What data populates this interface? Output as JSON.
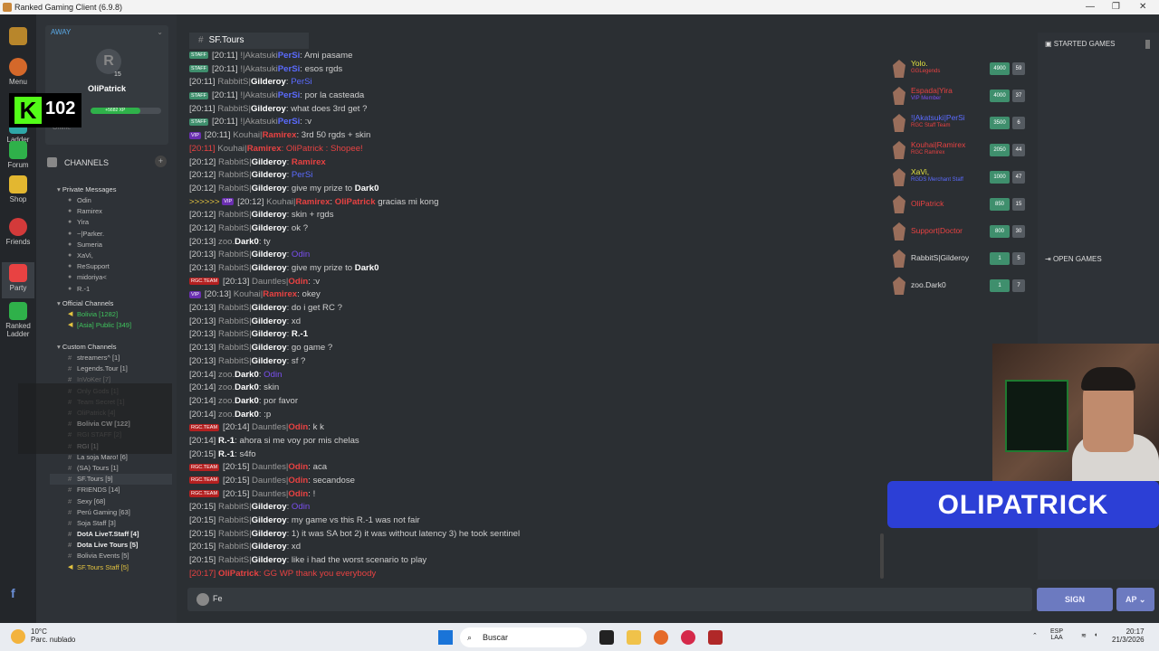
{
  "window": {
    "title": "Ranked Gaming Client (6.9.8)"
  },
  "nav": {
    "menu": "Menu",
    "ladder": "Ladder",
    "forum": "Forum",
    "shop": "Shop",
    "friends": "Friends",
    "party": "Party",
    "ranked_ladder_1": "Ranked",
    "ranked_ladder_2": "Ladder"
  },
  "profile": {
    "status": "AWAY",
    "name": "OliPatrick",
    "level": "15",
    "xp": "+5682 XP",
    "online": "Online"
  },
  "overlay": {
    "kick_count": "102",
    "kick_logo": "K"
  },
  "sidebar": {
    "channels_label": "CHANNELS",
    "private_header": "Private Messages",
    "private": [
      "Odin",
      "Ramirex",
      "Yira",
      "~|Parker.",
      "Sumeria",
      "XaVi,",
      "ReSupport",
      "midoriya<",
      "R.-1"
    ],
    "official_header": "Official Channels",
    "official": [
      "Bolivia [1282]",
      "[Asia] Public [349]"
    ],
    "custom_header": "Custom Channels",
    "custom": [
      "streamers^ [1]",
      "Legends.Tour [1]",
      "InVoKer [7]",
      "Only Gods [1]",
      "Team Secret [1]",
      "OliPatrick [4]",
      "Bolivia CW [122]",
      "RGI STAFF [2]",
      "RGI [1]",
      "La soja Maro! [6]",
      "(SA) Tours [1]",
      "SF.Tours [9]",
      "FRIENDS [14]",
      "Sexy [68]",
      "Perú Gaming [63]",
      "Soja Staff [3]",
      "DotA LiveT.Staff [4]",
      "Dota Live Tours [5]",
      "Bolivia Events [5]",
      "SF.Tours Staff [5]"
    ]
  },
  "channel_tab": {
    "name": "SF.Tours"
  },
  "chat": [
    {
      "badge": "STAFF",
      "ts": "[20:11]",
      "clan": "!|Akatsuki",
      "nm": "PerSi",
      "nmc": "blue",
      "text": "Ami pasame"
    },
    {
      "badge": "STAFF",
      "ts": "[20:11]",
      "clan": "!|Akatsuki",
      "nm": "PerSi",
      "nmc": "blue",
      "text": "esos rgds"
    },
    {
      "ts": "[20:11]",
      "clan": "RabbitS|",
      "nm": "Gilderoy",
      "text": "PerSi",
      "tc": "t-blue"
    },
    {
      "badge": "STAFF",
      "ts": "[20:11]",
      "clan": "!|Akatsuki",
      "nm": "PerSi",
      "nmc": "blue",
      "text": "por la casteada"
    },
    {
      "ts": "[20:11]",
      "clan": "RabbitS|",
      "nm": "Gilderoy",
      "text": "what does 3rd get ?"
    },
    {
      "badge": "STAFF",
      "ts": "[20:11]",
      "clan": "!|Akatsuki",
      "nm": "PerSi",
      "nmc": "blue",
      "text": ":v"
    },
    {
      "badge": "VIP",
      "ts": "[20:11]",
      "clan": "Kouhai|",
      "nm": "Ramirex",
      "nmc": "red",
      "text": "3rd 50 rgds + skin"
    },
    {
      "red": true,
      "ts": "[20:11]",
      "clan": "Kouhai|",
      "nm": "Ramirex",
      "nmc": "red",
      "text": "OliPatrick : Shopee!"
    },
    {
      "ts": "[20:12]",
      "clan": "RabbitS|",
      "nm": "Gilderoy",
      "text": "Ramirex",
      "tc": "t-red"
    },
    {
      "ts": "[20:12]",
      "clan": "RabbitS|",
      "nm": "Gilderoy",
      "text": "PerSi",
      "tc": "t-blue"
    },
    {
      "ts": "[20:12]",
      "clan": "RabbitS|",
      "nm": "Gilderoy",
      "text": "give my prize to ",
      "tail": "Dark0"
    },
    {
      "arrow": ">>>>>> ",
      "badge": "VIP",
      "ts": "[20:12]",
      "clan": "Kouhai|",
      "nm": "Ramirex",
      "nmc": "red",
      "text": "OliPatrick",
      "tc": "t-red",
      "tail2": " gracias mi kong"
    },
    {
      "ts": "[20:12]",
      "clan": "RabbitS|",
      "nm": "Gilderoy",
      "text": "skin + rgds"
    },
    {
      "ts": "[20:12]",
      "clan": "RabbitS|",
      "nm": "Gilderoy",
      "text": "ok ?"
    },
    {
      "ts": "[20:13]",
      "clan": "zoo.",
      "nm": "Dark0",
      "text": "ty"
    },
    {
      "ts": "[20:13]",
      "clan": "RabbitS|",
      "nm": "Gilderoy",
      "text": "Odin",
      "tc": "t-purple"
    },
    {
      "ts": "[20:13]",
      "clan": "RabbitS|",
      "nm": "Gilderoy",
      "text": "give my prize to ",
      "tail": "Dark0"
    },
    {
      "badge": "RGC.TEAM",
      "ts": "[20:13]",
      "clan": "Dauntles|",
      "nm": "Odin",
      "nmc": "red",
      "text": ":v"
    },
    {
      "badge": "VIP",
      "ts": "[20:13]",
      "clan": "Kouhai|",
      "nm": "Ramirex",
      "nmc": "red",
      "text": "okey"
    },
    {
      "ts": "[20:13]",
      "clan": "RabbitS|",
      "nm": "Gilderoy",
      "text": "do i get RC ?"
    },
    {
      "ts": "[20:13]",
      "clan": "RabbitS|",
      "nm": "Gilderoy",
      "text": "xd"
    },
    {
      "ts": "[20:13]",
      "clan": "RabbitS|",
      "nm": "Gilderoy",
      "text": "R.-1",
      "tc": "t-dark"
    },
    {
      "ts": "[20:13]",
      "clan": "RabbitS|",
      "nm": "Gilderoy",
      "text": "go game ?"
    },
    {
      "ts": "[20:13]",
      "clan": "RabbitS|",
      "nm": "Gilderoy",
      "text": "sf ?"
    },
    {
      "ts": "[20:14]",
      "clan": "zoo.",
      "nm": "Dark0",
      "text": "Odin",
      "tc": "t-purple"
    },
    {
      "ts": "[20:14]",
      "clan": "zoo.",
      "nm": "Dark0",
      "text": "skin"
    },
    {
      "ts": "[20:14]",
      "clan": "zoo.",
      "nm": "Dark0",
      "text": "por favor"
    },
    {
      "ts": "[20:14]",
      "clan": "zoo.",
      "nm": "Dark0",
      "text": ":p"
    },
    {
      "badge": "RGC.TEAM",
      "ts": "[20:14]",
      "clan": "Dauntles|",
      "nm": "Odin",
      "nmc": "red",
      "text": "k k"
    },
    {
      "ts": "[20:14]",
      "clan": "",
      "nm": "R.-1",
      "text": "ahora si me voy por mis chelas"
    },
    {
      "ts": "[20:15]",
      "clan": "",
      "nm": "R.-1",
      "text": "s4fo"
    },
    {
      "badge": "RGC.TEAM",
      "ts": "[20:15]",
      "clan": "Dauntles|",
      "nm": "Odin",
      "nmc": "red",
      "text": "aca"
    },
    {
      "badge": "RGC.TEAM",
      "ts": "[20:15]",
      "clan": "Dauntles|",
      "nm": "Odin",
      "nmc": "red",
      "text": "secandose"
    },
    {
      "badge": "RGC.TEAM",
      "ts": "[20:15]",
      "clan": "Dauntles|",
      "nm": "Odin",
      "nmc": "red",
      "text": "!"
    },
    {
      "ts": "[20:15]",
      "clan": "RabbitS|",
      "nm": "Gilderoy",
      "text": "Odin",
      "tc": "t-purple"
    },
    {
      "ts": "[20:15]",
      "clan": "RabbitS|",
      "nm": "Gilderoy",
      "text": "my game vs this R.-1 was not fair"
    },
    {
      "ts": "[20:15]",
      "clan": "RabbitS|",
      "nm": "Gilderoy",
      "text": "1) it was SA bot 2) it was without latency 3) he took sentinel"
    },
    {
      "ts": "[20:15]",
      "clan": "RabbitS|",
      "nm": "Gilderoy",
      "text": "xd"
    },
    {
      "ts": "[20:15]",
      "clan": "RabbitS|",
      "nm": "Gilderoy",
      "text": "like i had the worst scenario to play"
    },
    {
      "red": true,
      "ts": "[20:17]",
      "clan": "",
      "nm": "OliPatrick",
      "nmc": "red",
      "text": "GG WP thank you everybody"
    }
  ],
  "users": [
    {
      "name": "Yolo.",
      "nc": "#e3e340",
      "sub": "GGLegends",
      "sc2": "#e84242",
      "score": "4900",
      "lv": "59"
    },
    {
      "name": "Espada|Yira",
      "nc": "#e84242",
      "sub": "VIP Member",
      "sc2": "#7a4ff0",
      "score": "4000",
      "lv": "37"
    },
    {
      "name": "!|Akatsuki|PerSi",
      "nc": "#5b6bff",
      "sub": "RGC Staff Team",
      "sc2": "#e84242",
      "score": "3500",
      "lv": "6"
    },
    {
      "name": "Kouhai|Ramirex",
      "nc": "#e84242",
      "sub": "RGC Ramirex",
      "sc2": "#e84242",
      "score": "2050",
      "lv": "44"
    },
    {
      "name": "XaVi,",
      "nc": "#e3e340",
      "sub": "RGDS Merchant Staff",
      "sc2": "#5b6bff",
      "score": "1000",
      "lv": "47"
    },
    {
      "name": "OliPatrick",
      "nc": "#e84242",
      "sub": "",
      "sc2": "#aaa",
      "score": "850",
      "lv": "15"
    },
    {
      "name": "Support|Doctor",
      "nc": "#e84242",
      "sub": "",
      "sc2": "#aaa",
      "score": "800",
      "lv": "30"
    },
    {
      "name": "RabbitS|Gilderoy",
      "nc": "#dddddd",
      "sub": "",
      "sc2": "#aaa",
      "score": "1",
      "lv": "5"
    },
    {
      "name": "zoo.Dark0",
      "nc": "#dddddd",
      "sub": "",
      "sc2": "#aaa",
      "score": "1",
      "lv": "7"
    }
  ],
  "games": {
    "started": "STARTED GAMES",
    "open": "OPEN GAMES"
  },
  "banner": {
    "text": "OLIPATRICK"
  },
  "input": {
    "value": "Fe"
  },
  "buttons": {
    "sign": "SIGN",
    "ap": "AP"
  },
  "taskbar": {
    "temp": "10°C",
    "weather": "Parc. nublado",
    "search": "Buscar",
    "lang1": "ESP",
    "lang2": "LAA",
    "time": "20:17",
    "date": "21/3/2026"
  }
}
